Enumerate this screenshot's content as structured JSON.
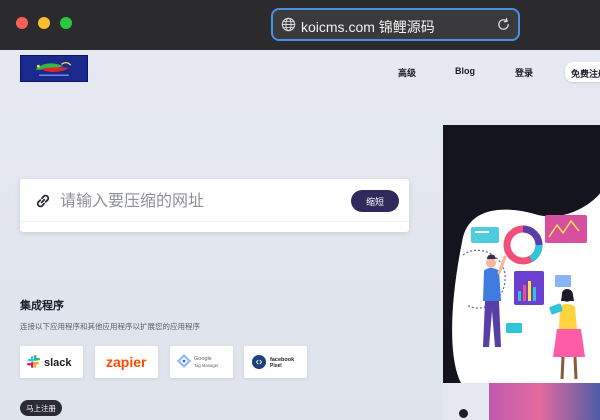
{
  "browser": {
    "url": "koicms.com 锦鲤源码",
    "accent": "#4a8fe7"
  },
  "nav": {
    "items": [
      "高级",
      "Blog",
      "登录"
    ],
    "signup": "免费注册"
  },
  "search": {
    "placeholder": "请输入要压缩的网址",
    "button": "缩短"
  },
  "integrations": {
    "title": "集成程序",
    "description": "连接以下应用程序和其他应用程序以扩展您的应用程序",
    "brands": [
      {
        "label": "slack",
        "icon": "slack-icon"
      },
      {
        "label": "zapier",
        "icon": "zapier-logo"
      },
      {
        "label": "Google",
        "sub": "Tag Manager",
        "icon": "google-tag-manager-icon"
      },
      {
        "label": "facebook",
        "sub": "Pixel",
        "icon": "facebook-pixel-icon"
      }
    ]
  },
  "cta": {
    "signup": "马上注册"
  },
  "colors": {
    "primary_button": "#2e2a5c",
    "dark_button": "#2b2b36",
    "page_background": "#e4e7ef",
    "zapier": "#ff4a00",
    "hero_background": "#14141e"
  }
}
